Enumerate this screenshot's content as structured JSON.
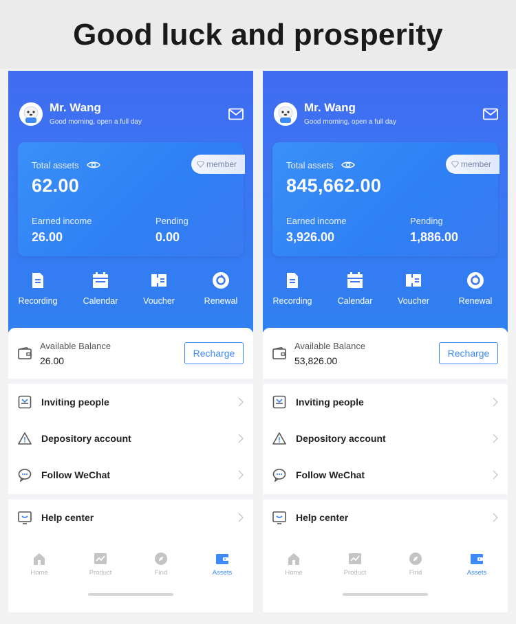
{
  "banner": {
    "title": "Good luck and prosperity"
  },
  "colors": {
    "primary": "#3d8af7",
    "hero_top": "#3f6cf0",
    "hero_bottom": "#2f80f1",
    "tab_inactive": "#b5b5b5"
  },
  "phones": [
    {
      "header": {
        "name": "Mr. Wang",
        "greeting": "Good morning, open a full day"
      },
      "card": {
        "total_label": "Total assets",
        "total_value": "62.00",
        "badge": "member",
        "earned_label": "Earned income",
        "earned_value": "26.00",
        "pending_label": "Pending",
        "pending_value": "0.00"
      },
      "quick": [
        {
          "label": "Recording",
          "icon": "document-icon"
        },
        {
          "label": "Calendar",
          "icon": "calendar-icon"
        },
        {
          "label": "Voucher",
          "icon": "ticket-icon"
        },
        {
          "label": "Renewal",
          "icon": "renewal-icon"
        }
      ],
      "balance": {
        "label": "Available Balance",
        "value": "26.00",
        "button": "Recharge"
      },
      "menu": [
        {
          "label": "Inviting people",
          "icon": "invite-icon"
        },
        {
          "label": "Depository account",
          "icon": "warning-icon"
        },
        {
          "label": "Follow WeChat",
          "icon": "chat-icon"
        }
      ],
      "menu2": [
        {
          "label": "Help center",
          "icon": "help-icon"
        }
      ],
      "tabs": [
        {
          "label": "Home",
          "icon": "home-icon"
        },
        {
          "label": "Product",
          "icon": "chart-icon"
        },
        {
          "label": "Find",
          "icon": "compass-icon"
        },
        {
          "label": "Assets",
          "icon": "wallet-icon",
          "active": true
        }
      ]
    },
    {
      "header": {
        "name": "Mr. Wang",
        "greeting": "Good morning, open a full day"
      },
      "card": {
        "total_label": "Total assets",
        "total_value": "845,662.00",
        "badge": "member",
        "earned_label": "Earned income",
        "earned_value": "3,926.00",
        "pending_label": "Pending",
        "pending_value": "1,886.00"
      },
      "quick": [
        {
          "label": "Recording",
          "icon": "document-icon"
        },
        {
          "label": "Calendar",
          "icon": "calendar-icon"
        },
        {
          "label": "Voucher",
          "icon": "ticket-icon"
        },
        {
          "label": "Renewal",
          "icon": "renewal-icon"
        }
      ],
      "balance": {
        "label": "Available Balance",
        "value": "53,826.00",
        "button": "Recharge"
      },
      "menu": [
        {
          "label": "Inviting people",
          "icon": "invite-icon"
        },
        {
          "label": "Depository account",
          "icon": "warning-icon"
        },
        {
          "label": "Follow WeChat",
          "icon": "chat-icon"
        }
      ],
      "menu2": [
        {
          "label": "Help center",
          "icon": "help-icon"
        }
      ],
      "tabs": [
        {
          "label": "Home",
          "icon": "home-icon"
        },
        {
          "label": "Product",
          "icon": "chart-icon"
        },
        {
          "label": "Find",
          "icon": "compass-icon"
        },
        {
          "label": "Assets",
          "icon": "wallet-icon",
          "active": true
        }
      ]
    }
  ]
}
